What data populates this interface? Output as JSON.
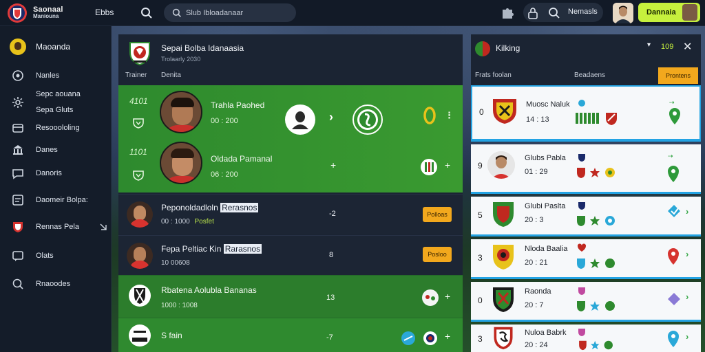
{
  "topbar": {
    "brand_line1": "Saonaal",
    "brand_line2": "Maniouna",
    "nav_link": "Ebbs",
    "search_text": "Slub Ibloadanaar",
    "account_text": "Nemasls",
    "cta_label": "Dannaia"
  },
  "sidebar": {
    "user_name": "Maoanda",
    "items": [
      {
        "label": "Nanles",
        "icon": "dashboard-icon"
      },
      {
        "label": "Sepc aouana",
        "sub": "Sepa Gluts",
        "icon": "settings-icon"
      },
      {
        "label": "Resooololing",
        "icon": "wallet-icon"
      },
      {
        "label": "Danes",
        "icon": "bank-icon"
      },
      {
        "label": "Danoris",
        "icon": "chat-icon"
      },
      {
        "label": "Daomeir Bolpa:",
        "icon": "tablet-icon"
      },
      {
        "label": "Rennas Pela",
        "icon": "club-badge-icon"
      },
      {
        "label": "Olats",
        "icon": "message-icon"
      },
      {
        "label": "Rnaoodes",
        "icon": "search-icon"
      }
    ]
  },
  "main": {
    "title": "Sepai Bolba Idanaasia",
    "subtitle": "Trolaarly 2030",
    "col_trainer": "Trainer",
    "col_name": "Denita",
    "green_rows": [
      {
        "time": "4101",
        "name": "Trahla Paohed",
        "score": "00 : 200"
      },
      {
        "time": "1101",
        "name": "Oldada Pamanal",
        "score": "06 : 200"
      }
    ],
    "player_rows": [
      {
        "name": "Peponoldadloln",
        "name_hl": "Rerasnos",
        "meta": "00 : 1000",
        "meta_hl": "Posfet",
        "num": "-2",
        "tag": "Polloas"
      },
      {
        "name": "Fepa Peltiac Kin",
        "name_hl": "Rarasnos",
        "meta": "10 00608",
        "meta_hl": "",
        "num": "8",
        "tag": "Posloo"
      }
    ],
    "club_rows": [
      {
        "name": "Rbatena Aolubla Bananas",
        "meta": "1000 : 1008",
        "num": "13"
      },
      {
        "name": "S fain",
        "meta": "",
        "num": "-7"
      }
    ]
  },
  "right": {
    "title": "Kilking",
    "counter": "109",
    "col_left": "Frats foolan",
    "col_right": "Beadaens",
    "button": "Prontens",
    "cards": [
      {
        "rank": "0",
        "name": "Muosc Naluk",
        "score": "14 : 13"
      },
      {
        "rank": "9",
        "name": "Glubs Pabla",
        "score": "01 : 29"
      },
      {
        "rank": "5",
        "name": "Glubi Paslta",
        "score": "20 : 3"
      },
      {
        "rank": "3",
        "name": "Nloda Baalia",
        "score": "20 : 21"
      },
      {
        "rank": "0",
        "name": "Raonda",
        "score": "20 : 7"
      },
      {
        "rank": "3",
        "name": "Nuloa Babrk",
        "score": "20 : 24"
      }
    ]
  },
  "colors": {
    "accent": "#c6f03d",
    "pitch": "#2e8a2e",
    "tag": "#f2a81d",
    "selection": "#23a3e3"
  }
}
